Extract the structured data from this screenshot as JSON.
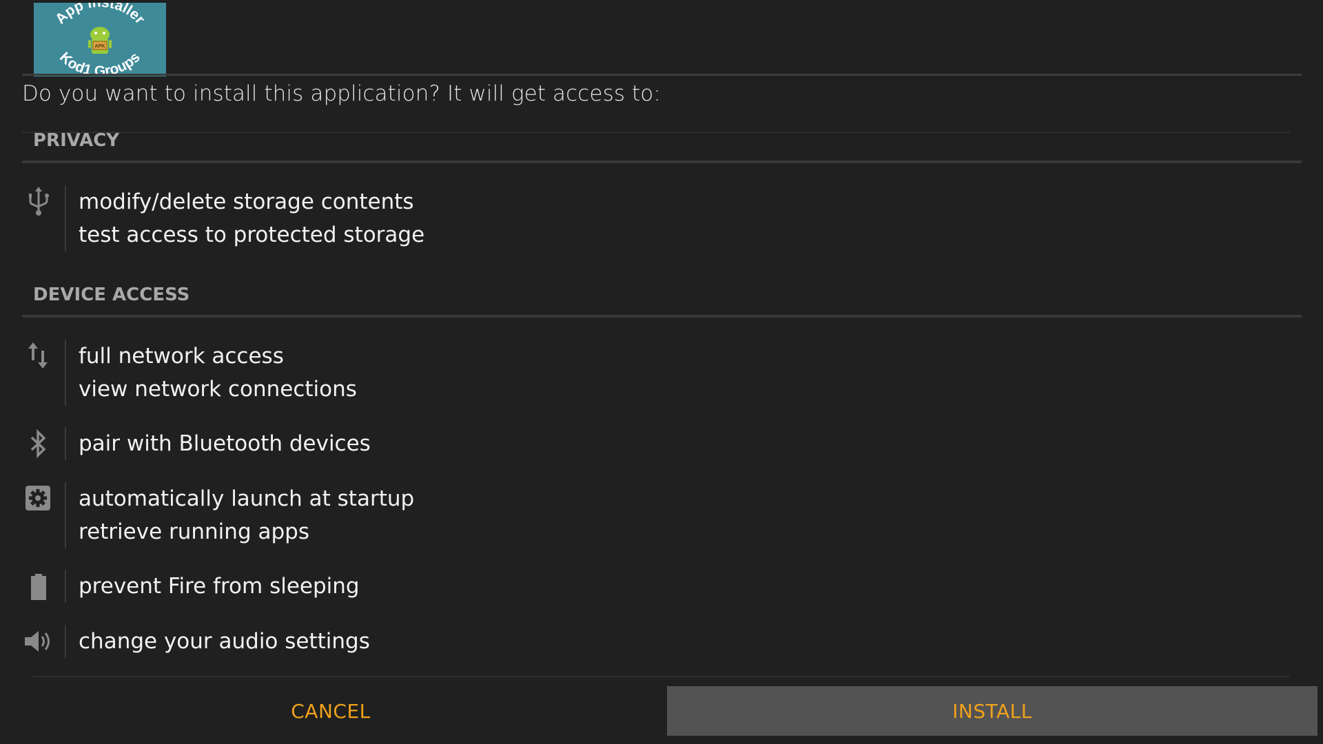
{
  "app_logo": {
    "text_top": "App installer",
    "text_bottom": "Kod1 Groups",
    "badge": "APK",
    "background": "#3e8a99"
  },
  "prompt": "Do you want to install this application? It will get access to:",
  "sections": [
    {
      "label": "PRIVACY",
      "groups": [
        {
          "icon": "usb-icon",
          "items": [
            "modify/delete storage contents",
            "test access to protected storage"
          ]
        }
      ]
    },
    {
      "label": "DEVICE ACCESS",
      "groups": [
        {
          "icon": "network-arrows-icon",
          "items": [
            "full network access",
            "view network connections"
          ]
        },
        {
          "icon": "bluetooth-icon",
          "items": [
            "pair with Bluetooth devices"
          ]
        },
        {
          "icon": "settings-gear-icon",
          "items": [
            "automatically launch at startup",
            "retrieve running apps"
          ]
        },
        {
          "icon": "battery-icon",
          "items": [
            "prevent Fire from sleeping"
          ]
        },
        {
          "icon": "speaker-icon",
          "items": [
            "change your audio settings"
          ]
        }
      ]
    }
  ],
  "buttons": {
    "cancel": "CANCEL",
    "install": "INSTALL"
  },
  "colors": {
    "background": "#202020",
    "accent": "#f0a21a",
    "install_button_bg": "#535353"
  }
}
